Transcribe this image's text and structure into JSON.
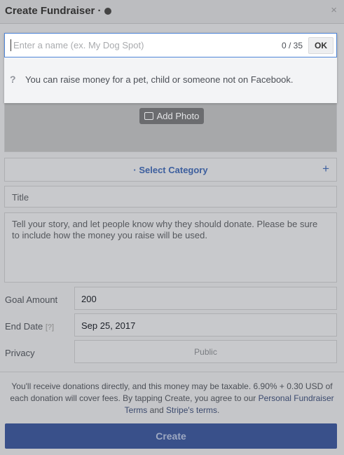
{
  "header": {
    "title": "Create Fundraiser ·",
    "close_glyph": "×"
  },
  "name_field": {
    "placeholder": "Enter a name (ex. My Dog Spot)",
    "value": "",
    "counter": "0 / 35",
    "ok_label": "OK"
  },
  "hint": {
    "icon_glyph": "❔",
    "text": "You can raise money for a pet, child or someone not on Facebook."
  },
  "photo": {
    "add_label": "Add Photo"
  },
  "category": {
    "label": "· Select Category",
    "plus_glyph": "+"
  },
  "title_field": {
    "placeholder": "Title"
  },
  "story_field": {
    "placeholder": "Tell your story, and let people know why they should donate. Please be sure to include how the money you raise will be used."
  },
  "goal": {
    "label": "Goal Amount",
    "value": "200"
  },
  "end_date": {
    "label": "End Date",
    "help": "[?]",
    "value": "Sep 25, 2017"
  },
  "privacy": {
    "label": "Privacy",
    "value": "Public"
  },
  "footer": {
    "text_1": "You'll receive donations directly, and this money may be taxable. 6.90% + 0.30 USD of each donation will cover fees. By tapping Create, you agree to our ",
    "link_1": "Personal Fundraiser Terms",
    "text_2": " and ",
    "link_2": "Stripe's terms",
    "text_3": "."
  },
  "create_label": "Create",
  "colors": {
    "accent": "#4f86d8",
    "link": "#3d5f9e",
    "create_button": "#39508a"
  }
}
